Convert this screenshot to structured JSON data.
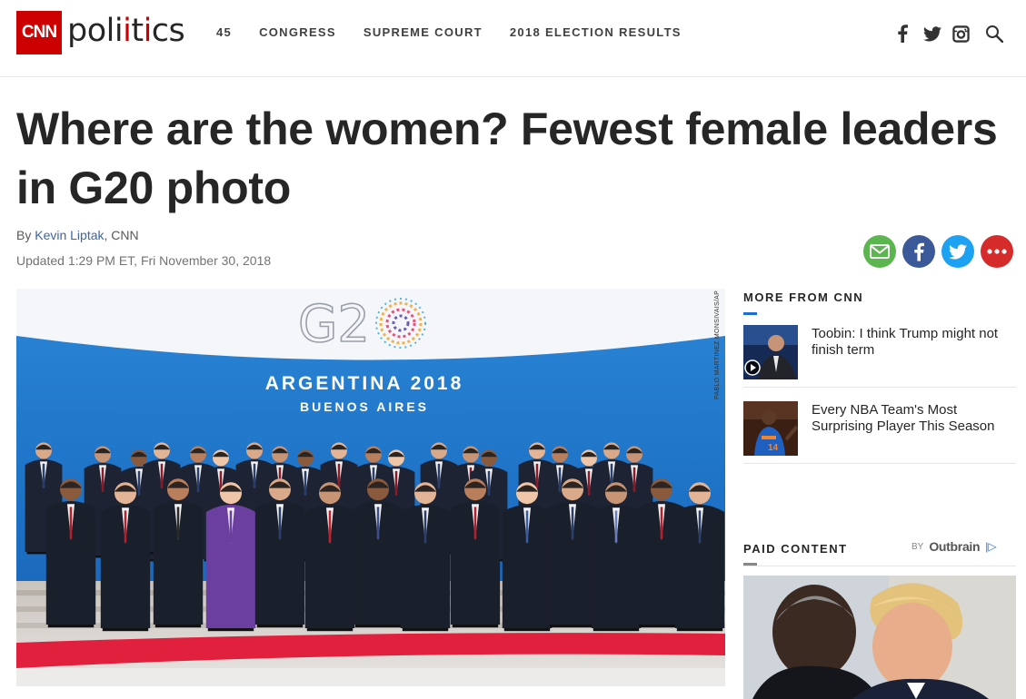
{
  "header": {
    "logo_text": "CNN",
    "section_word_before": "poli",
    "section_word_i": "t",
    "section_word_after": "ics",
    "nav": [
      "45",
      "CONGRESS",
      "SUPREME COURT",
      "2018 ELECTION RESULTS"
    ],
    "icons": [
      "facebook-icon",
      "twitter-icon",
      "instagram-icon",
      "search-icon"
    ]
  },
  "article": {
    "headline": "Where are the women? Fewest female leaders in G20 photo",
    "by_prefix": "By ",
    "author": "Kevin Liptak",
    "by_suffix": ", CNN",
    "updated": "Updated 1:29 PM ET, Fri November 30, 2018",
    "share": [
      "email-share-icon",
      "facebook-share-icon",
      "twitter-share-icon",
      "more-share-icon"
    ],
    "hero": {
      "g20": "G2",
      "banner_line1": "ARGENTINA 2018",
      "banner_line2": "BUENOS AIRES",
      "credit": "PABLO MARTINEZ MONSIVAIS/AP"
    }
  },
  "rail": {
    "more_title": "MORE FROM CNN",
    "items": [
      {
        "title": "Toobin: I think Trump might not finish term"
      },
      {
        "title": "Every NBA Team's Most Surprising Player This Season"
      }
    ],
    "paid_title": "PAID CONTENT",
    "by_label": "BY",
    "outbrain": "Outbrain",
    "outbrain_mark": "|▷"
  },
  "colors": {
    "brand_red": "#cc0000",
    "email_green": "#5bb64f",
    "facebook_blue": "#3b5998",
    "twitter_blue": "#1da1f2",
    "more_red": "#d52b2b"
  }
}
